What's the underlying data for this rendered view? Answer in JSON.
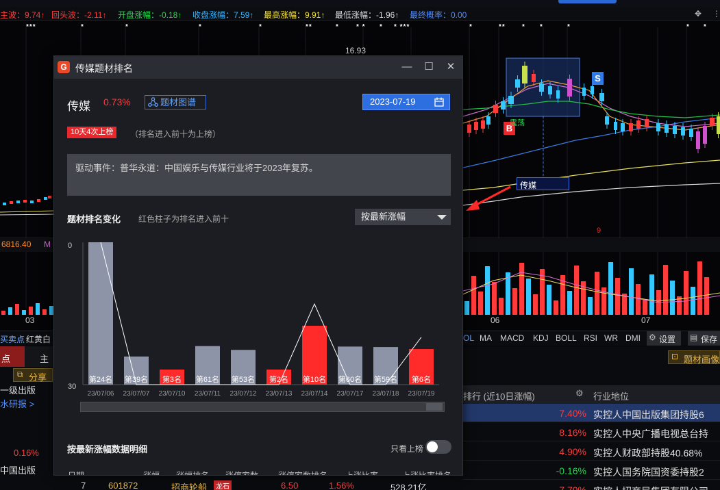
{
  "statbar": {
    "items": [
      {
        "label": "主波：9.74↑",
        "color": "red"
      },
      {
        "label": "回头波：-2.11↑",
        "color": "red"
      },
      {
        "label": "开盘涨幅：-0.18↑",
        "color": "green"
      },
      {
        "label": "收盘涨幅：7.59↑",
        "color": "cyan"
      },
      {
        "label": "最高涨幅：9.91↑",
        "color": "yellow"
      },
      {
        "label": "最低涨幅：-1.96↑",
        "color": "white"
      },
      {
        "label": "最终概率：0.00",
        "color": "blue"
      }
    ]
  },
  "chart": {
    "price_label": "16.93",
    "sector_label": "传媒",
    "buy_marker": "B",
    "sell_marker": "S",
    "side_price": "6816.40",
    "side_m": "M",
    "month_labels": [
      "03",
      "06",
      "07"
    ],
    "nine_label": "9",
    "shock_label": "震荡"
  },
  "indicator_tabs": {
    "left": [
      "买卖点",
      "红黄白"
    ],
    "right": [
      "OL",
      "MA",
      "MACD",
      "KDJ",
      "BOLL",
      "RSI",
      "WR",
      "DMI"
    ],
    "settings": "设置",
    "save": "保存"
  },
  "lower": {
    "tab_buy": "点",
    "tab_main": "主",
    "share": "分享",
    "left_text1": "一级出版",
    "left_link": "水研报 >",
    "left_pct": "0.16%",
    "left_text2": "中国出版",
    "theme_btn": "题材画像",
    "col_rank": "排行 (近10日涨幅)",
    "col_industry": "行业地位",
    "rows": [
      {
        "pct": "7.40%",
        "desc": "实控人中国出版集团持股6"
      },
      {
        "pct": "8.16%",
        "desc": "实控人中央广播电视总台持"
      },
      {
        "pct": "4.90%",
        "desc": "实控人财政部持股40.68%"
      },
      {
        "pct": "-0.16%",
        "desc": "实控人国务院国资委持股2"
      },
      {
        "pct": "7.79%",
        "desc": "实控人招商局集团有限公司"
      }
    ],
    "bottom_num": "7",
    "bottom_code": "601872",
    "bottom_name": "招商轮船",
    "bottom_tag": "龙石",
    "bottom_v1": "6.50",
    "bottom_v2": "1.56%",
    "bottom_v3": "528.21亿"
  },
  "modal": {
    "title": "传媒题材排名",
    "logo": "G",
    "min_icon": "—",
    "max_icon": "☐",
    "close_icon": "✕",
    "stock_name": "传媒",
    "stock_pct": "0.73%",
    "graph_button": "题材图谱",
    "date": "2023-07-19",
    "badge": "10天4次上榜",
    "badge_note": "（排名进入前十为上榜）",
    "event": "驱动事件：普华永道：中国娱乐与传媒行业将于2023年复苏。",
    "section_title": "题材排名变化",
    "section_note": "红色柱子为排名进入前十",
    "sort_label": "按最新涨幅",
    "detail_title": "按最新涨幅数据明细",
    "toggle_label": "只看上榜",
    "detail_headers": [
      "日期",
      "涨幅",
      "涨幅排名",
      "涨停家数",
      "涨停家数排名",
      "上涨比率",
      "上涨比率排名"
    ]
  },
  "chart_data": {
    "type": "bar",
    "categories": [
      "23/07/06",
      "23/07/07",
      "23/07/10",
      "23/07/11",
      "23/07/12",
      "23/07/13",
      "23/07/14",
      "23/07/17",
      "23/07/18",
      "23/07/19"
    ],
    "values": [
      24,
      39,
      3,
      61,
      53,
      2,
      10,
      60,
      59,
      6
    ],
    "labels": [
      "第24名",
      "第39名",
      "第3名",
      "第61名",
      "第53名",
      "第2名",
      "第10名",
      "第60名",
      "第59名",
      "第6名"
    ],
    "line_values": [
      0,
      30,
      30,
      30,
      30,
      30,
      13,
      30,
      30,
      20
    ],
    "ylabels": [
      "0",
      "30"
    ],
    "colors": {
      "top10": "#ff2a2a",
      "normal": "#8e94a8",
      "line": "#ffffff"
    }
  }
}
